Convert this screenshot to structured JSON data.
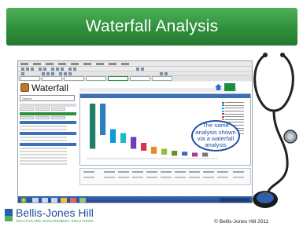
{
  "slide": {
    "title": "Waterfall Analysis",
    "callout": {
      "line1": "The same",
      "line2": "analysis shown",
      "line3": "via a waterfall",
      "line4": "analysis"
    },
    "footer": {
      "logo_name": "Bellis-Jones Hill",
      "logo_tagline": "HEALTHCARE MANAGEMENT SOLUTIONS",
      "copyright": "© Bellis-Jones Hill 2011"
    },
    "colors": {
      "title_green": "#2f8f3c",
      "callout_blue": "#1f4fa6",
      "brand_blue": "#1f4f9b"
    }
  },
  "screenshot": {
    "app_title": "Waterfall",
    "search_placeholder": "Search"
  },
  "chart_data": {
    "type": "bar",
    "bars": [
      {
        "offset": 0,
        "height": 46,
        "color": "#1f7f6a"
      },
      {
        "offset": 0,
        "height": 32,
        "color": "#2a7fbf"
      },
      {
        "offset": 26,
        "height": 14,
        "color": "#0e9bd8"
      },
      {
        "offset": 30,
        "height": 10,
        "color": "#23b7c9"
      },
      {
        "offset": 34,
        "height": 12,
        "color": "#6c3fb5"
      },
      {
        "offset": 40,
        "height": 8,
        "color": "#d7354a"
      },
      {
        "offset": 44,
        "height": 7,
        "color": "#e38b26"
      },
      {
        "offset": 46,
        "height": 6,
        "color": "#8fbf3a"
      },
      {
        "offset": 48,
        "height": 5,
        "color": "#6b8e23"
      },
      {
        "offset": 49,
        "height": 4,
        "color": "#3d6fb5"
      },
      {
        "offset": 50,
        "height": 4,
        "color": "#b03a8f"
      },
      {
        "offset": 50,
        "height": 4,
        "color": "#777777"
      }
    ],
    "legend_colors": [
      "#1f7f6a",
      "#2a7fbf",
      "#0e9bd8",
      "#23b7c9",
      "#6c3fb5",
      "#d7354a",
      "#e38b26",
      "#8fbf3a",
      "#6b8e23",
      "#3d6fb5",
      "#b03a8f",
      "#777777"
    ]
  }
}
